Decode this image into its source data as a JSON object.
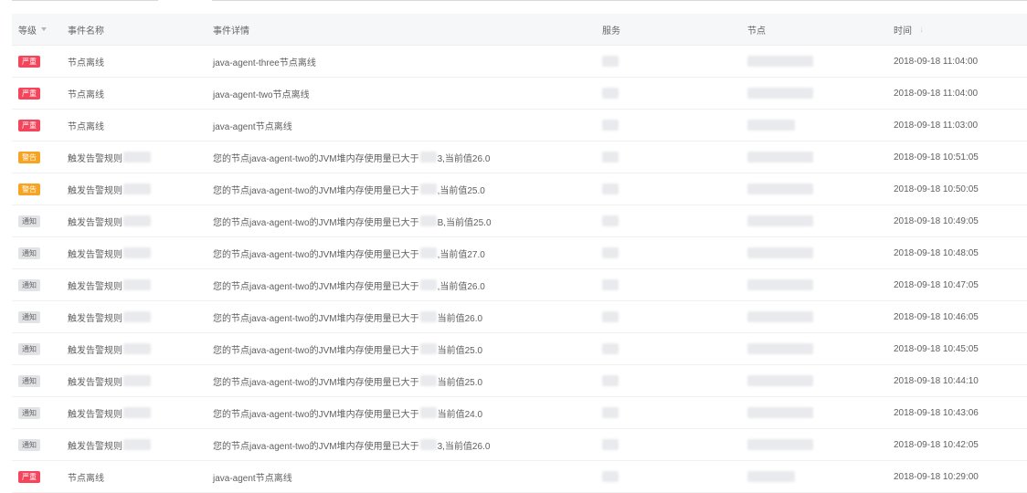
{
  "table": {
    "headers": {
      "level": "等级",
      "name": "事件名称",
      "detail": "事件详情",
      "service": "服务",
      "node": "节点",
      "time": "时间"
    },
    "rows": [
      {
        "level": "严重",
        "level_type": "critical",
        "name": "节点离线",
        "name_blurred": false,
        "detail_prefix": "java-agent-three节点离线",
        "detail_blurred": false,
        "detail_suffix": "",
        "service": "",
        "node": "",
        "time": "2018-09-18 11:04:00"
      },
      {
        "level": "严重",
        "level_type": "critical",
        "name": "节点离线",
        "name_blurred": false,
        "detail_prefix": "java-agent-two节点离线",
        "detail_blurred": false,
        "detail_suffix": "",
        "service": "",
        "node": "",
        "time": "2018-09-18 11:04:00"
      },
      {
        "level": "严重",
        "level_type": "critical",
        "name": "节点离线",
        "name_blurred": false,
        "detail_prefix": "java-agent节点离线",
        "detail_blurred": false,
        "detail_suffix": "",
        "service": "",
        "node": "",
        "time": "2018-09-18 11:03:00"
      },
      {
        "level": "警告",
        "level_type": "warning",
        "name": "触发告警规则",
        "name_blurred": true,
        "detail_prefix": "您的节点java-agent-two的JVM堆内存使用量已大于",
        "detail_blurred": true,
        "detail_suffix": "3,当前值26.0",
        "service": "",
        "node": "",
        "time": "2018-09-18 10:51:05"
      },
      {
        "level": "警告",
        "level_type": "warning",
        "name": "触发告警规则",
        "name_blurred": true,
        "detail_prefix": "您的节点java-agent-two的JVM堆内存使用量已大于",
        "detail_blurred": true,
        "detail_suffix": ",当前值25.0",
        "service": "",
        "node": "",
        "time": "2018-09-18 10:50:05"
      },
      {
        "level": "通知",
        "level_type": "notice",
        "name": "触发告警规则",
        "name_blurred": true,
        "detail_prefix": "您的节点java-agent-two的JVM堆内存使用量已大于",
        "detail_blurred": true,
        "detail_suffix": "B,当前值25.0",
        "service": "",
        "node": "",
        "time": "2018-09-18 10:49:05"
      },
      {
        "level": "通知",
        "level_type": "notice",
        "name": "触发告警规则",
        "name_blurred": true,
        "detail_prefix": "您的节点java-agent-two的JVM堆内存使用量已大于",
        "detail_blurred": true,
        "detail_suffix": ",当前值27.0",
        "service": "",
        "node": "",
        "time": "2018-09-18 10:48:05"
      },
      {
        "level": "通知",
        "level_type": "notice",
        "name": "触发告警规则",
        "name_blurred": true,
        "detail_prefix": "您的节点java-agent-two的JVM堆内存使用量已大于",
        "detail_blurred": true,
        "detail_suffix": ",当前值26.0",
        "service": "",
        "node": "",
        "time": "2018-09-18 10:47:05"
      },
      {
        "level": "通知",
        "level_type": "notice",
        "name": "触发告警规则",
        "name_blurred": true,
        "detail_prefix": "您的节点java-agent-two的JVM堆内存使用量已大于",
        "detail_blurred": true,
        "detail_suffix": "当前值26.0",
        "service": "",
        "node": "",
        "time": "2018-09-18 10:46:05"
      },
      {
        "level": "通知",
        "level_type": "notice",
        "name": "触发告警规则",
        "name_blurred": true,
        "detail_prefix": "您的节点java-agent-two的JVM堆内存使用量已大于",
        "detail_blurred": true,
        "detail_suffix": "当前值25.0",
        "service": "",
        "node": "",
        "time": "2018-09-18 10:45:05"
      },
      {
        "level": "通知",
        "level_type": "notice",
        "name": "触发告警规则",
        "name_blurred": true,
        "detail_prefix": "您的节点java-agent-two的JVM堆内存使用量已大于",
        "detail_blurred": true,
        "detail_suffix": "当前值25.0",
        "service": "",
        "node": "",
        "time": "2018-09-18 10:44:10"
      },
      {
        "level": "通知",
        "level_type": "notice",
        "name": "触发告警规则",
        "name_blurred": true,
        "detail_prefix": "您的节点java-agent-two的JVM堆内存使用量已大于",
        "detail_blurred": true,
        "detail_suffix": "当前值24.0",
        "service": "",
        "node": "",
        "time": "2018-09-18 10:43:06"
      },
      {
        "level": "通知",
        "level_type": "notice",
        "name": "触发告警规则",
        "name_blurred": true,
        "detail_prefix": "您的节点java-agent-two的JVM堆内存使用量已大于",
        "detail_blurred": true,
        "detail_suffix": "3,当前值26.0",
        "service": "",
        "node": "",
        "time": "2018-09-18 10:42:05"
      },
      {
        "level": "严重",
        "level_type": "critical",
        "name": "节点离线",
        "name_blurred": false,
        "detail_prefix": "java-agent节点离线",
        "detail_blurred": false,
        "detail_suffix": "",
        "service": "",
        "node": "",
        "time": "2018-09-18 10:29:00"
      }
    ]
  },
  "colors": {
    "critical": "#f5455c",
    "warning": "#f7a423",
    "notice": "#e2e3e6",
    "header_bg": "#f6f7f9"
  }
}
